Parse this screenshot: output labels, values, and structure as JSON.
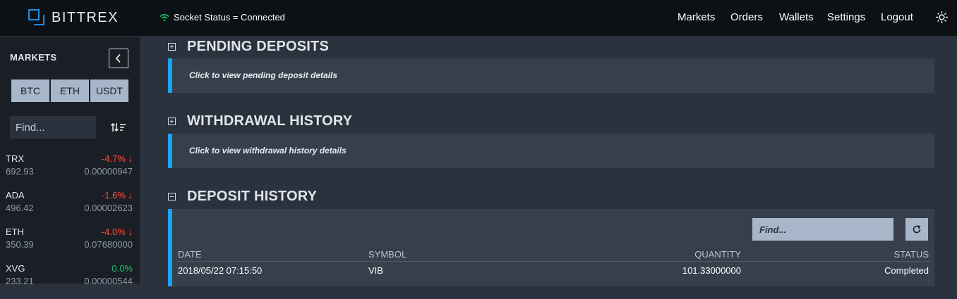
{
  "brand": {
    "name": "BITTREX",
    "accent": "#1f8ee6"
  },
  "socket": {
    "status": "Socket Status = Connected",
    "icon": "wifi-icon",
    "color": "#1fc16b"
  },
  "nav": {
    "markets": "Markets",
    "orders": "Orders",
    "wallets": "Wallets",
    "settings": "Settings",
    "logout": "Logout",
    "theme_icon": "sun-icon"
  },
  "sidebar": {
    "title": "MARKETS",
    "collapse_icon": "chevron-left-icon",
    "tabs": [
      "BTC",
      "ETH",
      "USDT"
    ],
    "find_placeholder": "Find...",
    "sort_icon": "sort-icon",
    "markets": [
      {
        "symbol": "TRX",
        "volume": "692.93",
        "change": "-4.7% ↓",
        "price": "0.00000947",
        "direction": "down"
      },
      {
        "symbol": "ADA",
        "volume": "496.42",
        "change": "-1.6% ↓",
        "price": "0.00002623",
        "direction": "down"
      },
      {
        "symbol": "ETH",
        "volume": "350.39",
        "change": "-4.0% ↓",
        "price": "0.07680000",
        "direction": "down"
      },
      {
        "symbol": "XVG",
        "volume": "233.21",
        "change": "0.0%",
        "price": "0.00000544",
        "direction": "flat"
      }
    ]
  },
  "sections": {
    "pending": {
      "title": "PENDING DEPOSITS",
      "link": "Click to view pending deposit details",
      "state": "collapsed"
    },
    "withdrawal": {
      "title": "WITHDRAWAL HISTORY",
      "link": "Click to view withdrawal history details",
      "state": "collapsed"
    },
    "deposit": {
      "title": "DEPOSIT HISTORY",
      "state": "expanded",
      "find_placeholder": "Find...",
      "refresh_icon": "refresh-icon",
      "columns": {
        "date": "DATE",
        "symbol": "SYMBOL",
        "quantity": "QUANTITY",
        "status": "STATUS"
      },
      "rows": [
        {
          "date": "2018/05/22 07:15:50",
          "symbol": "VIB",
          "quantity": "101.33000000",
          "status": "Completed"
        }
      ]
    }
  },
  "colors": {
    "accent_bar": "#1da1f2",
    "negative": "#ff4d3d",
    "positive": "#1fc16b"
  }
}
